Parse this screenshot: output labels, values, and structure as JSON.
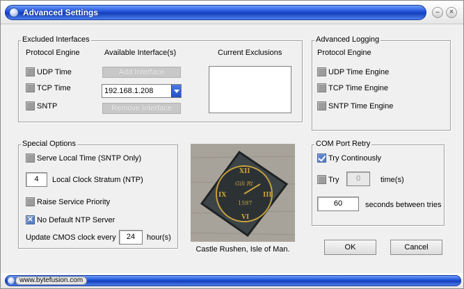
{
  "window": {
    "title": "Advanced Settings"
  },
  "excluded": {
    "label": "Excluded Interfaces",
    "col_protocol": "Protocol Engine",
    "col_available": "Available Interface(s)",
    "col_current": "Current Exclusions",
    "udp": "UDP Time",
    "tcp": "TCP Time",
    "sntp": "SNTP",
    "add_button": "Add Interface",
    "remove_button": "Remove Interface",
    "interface_value": "192.168.1.208"
  },
  "logging": {
    "label": "Advanced Logging",
    "col_protocol": "Protocol Engine",
    "udp": "UDP Time Engine",
    "tcp": "TCP Time Engine",
    "sntp": "SNTP Time Engine"
  },
  "special": {
    "label": "Special Options",
    "serve_local": "Serve Local Time (SNTP Only)",
    "stratum_value": "4",
    "stratum_label": "Local Clock Stratum (NTP)",
    "raise_priority": "Raise Service Priority",
    "no_default_ntp": "No Default NTP Server",
    "cmos_label": "Update CMOS clock every",
    "cmos_value": "24",
    "cmos_unit": "hour(s)"
  },
  "image": {
    "caption": "Castle Rushen, Isle of Man.",
    "clock_text": "Gili Rt",
    "clock_year": "1597"
  },
  "com_retry": {
    "label": "COM Port Retry",
    "try_continuously": "Try Continously",
    "try_label": "Try",
    "try_value": "0",
    "times_label": "time(s)",
    "seconds_value": "60",
    "seconds_label": "seconds between tries"
  },
  "buttons": {
    "ok": "OK",
    "cancel": "Cancel"
  },
  "status": {
    "link": "www.bytefusion.com"
  },
  "colors": {
    "accent": "#1d4fd8",
    "checkbox": "#9c9c9c",
    "checked": "#5a82c8"
  }
}
